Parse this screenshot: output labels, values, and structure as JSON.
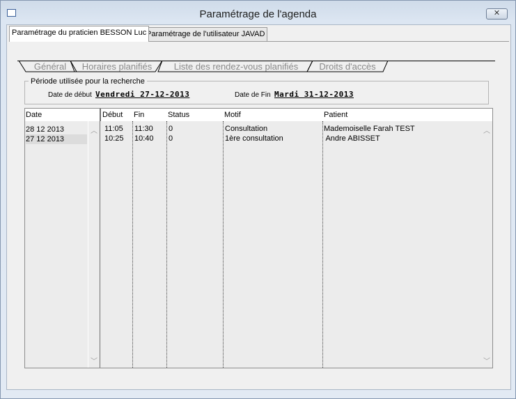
{
  "window": {
    "title": "Paramétrage de l'agenda",
    "close_glyph": "✕"
  },
  "top_tabs": [
    {
      "label": "Paramétrage du praticien BESSON Luc",
      "active": true
    },
    {
      "label": "Paramétrage de l'utilisateur JAVAD",
      "active": false
    }
  ],
  "sub_tabs": [
    {
      "label": "Général"
    },
    {
      "label": "Horaires planifiés"
    },
    {
      "label": "Liste des rendez-vous planifiés"
    },
    {
      "label": "Droits d'accès"
    }
  ],
  "periode": {
    "legend": "Période utilisée pour la recherche",
    "debut_label": "Date de début",
    "debut_value": "Vendredi 27-12-2013",
    "fin_label": "Date de Fin",
    "fin_value": "Mardi 31-12-2013"
  },
  "table": {
    "date_header": "Date",
    "columns": [
      "Début",
      "Fin",
      "Status",
      "Motif",
      "Patient"
    ],
    "dates": [
      "28 12 2013",
      "27 12 2013"
    ],
    "rows": [
      {
        "debut": "11:05",
        "fin": "11:30",
        "status": "0",
        "motif": "Consultation",
        "patient": "Mademoiselle Farah TEST"
      },
      {
        "debut": "10:25",
        "fin": "10:40",
        "status": "0",
        "motif": "1ère consultation",
        "patient": " Andre ABISSET"
      }
    ]
  },
  "icons": {
    "scroll_up": "chevron-up-icon",
    "scroll_down": "chevron-down-icon"
  }
}
